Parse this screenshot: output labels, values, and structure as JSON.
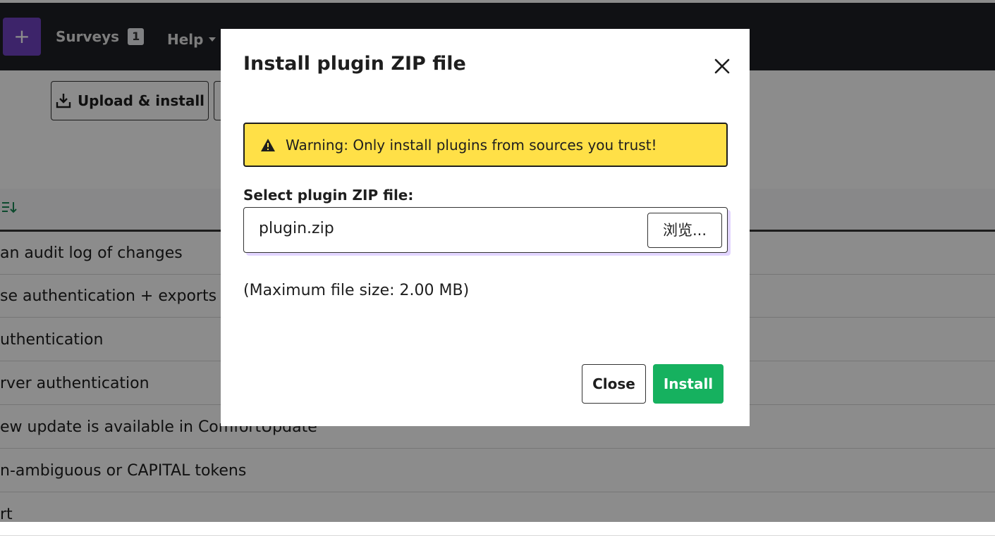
{
  "navbar": {
    "add_label": "+",
    "surveys_label": "Surveys",
    "surveys_count": "1",
    "help_label": "Help"
  },
  "toolbar": {
    "upload_install_label": "Upload & install"
  },
  "table": {
    "rows": [
      "an audit log of changes",
      "se authentication + exports",
      "uthentication",
      "rver authentication",
      "ew update is available in ComfortUpdate",
      "n-ambiguous or CAPITAL tokens",
      "rt"
    ]
  },
  "modal": {
    "title": "Install plugin ZIP file",
    "warning_text": "Warning: Only install plugins from sources you trust!",
    "field_label": "Select plugin ZIP file:",
    "file_name": "plugin.zip",
    "browse_label": "浏览...",
    "max_size_text": "(Maximum file size: 2.00 MB)",
    "close_label": "Close",
    "install_label": "Install"
  },
  "colors": {
    "navbar_bg": "#1e1f25",
    "add_button": "#6f42c1",
    "warning_bg": "#ffe047",
    "install_button": "#16b15f",
    "sort_icon": "#198754"
  },
  "icons": {
    "upload": "download-tray-icon",
    "sort": "sort-list-icon",
    "warning": "warning-triangle-icon",
    "close": "close-icon"
  }
}
